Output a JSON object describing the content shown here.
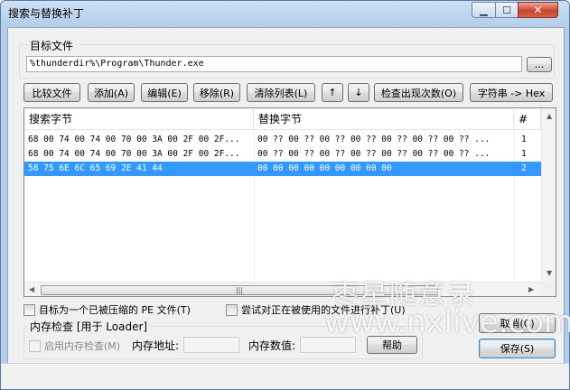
{
  "window": {
    "title": "搜索与替换补丁",
    "min_glyph": "▁",
    "max_glyph": "☐",
    "close_glyph": "✕"
  },
  "target": {
    "label": "目标文件",
    "path": "%thunderdir%\\Program\\Thunder.exe",
    "browse_label": "..."
  },
  "toolbar": {
    "compare": "比较文件",
    "add": "添加(A)",
    "edit": "编辑(E)",
    "remove": "移除(R)",
    "clear": "清除列表(L)",
    "up": "↑",
    "down": "↓",
    "check_count": "检查出现次数(O)",
    "str_to_hex": "字符串 -> Hex"
  },
  "list": {
    "columns": [
      "搜索字节",
      "替换字节",
      "#"
    ],
    "rows": [
      {
        "search": "68 00 74 00 74 00 70 00 3A 00 2F 00 2F...",
        "replace": "00 ?? 00 ?? 00 ?? 00 ?? 00 ?? 00 ?? 00 ?? ...",
        "count": "1",
        "selected": false
      },
      {
        "search": "68 00 74 00 74 00 70 00 3A 00 2F 00 2F...",
        "replace": "00 ?? 00 ?? 00 ?? 00 ?? 00 ?? 00 ?? 00 ?? ...",
        "count": "1",
        "selected": false
      },
      {
        "search": "58 75 6E 6C 65 69 2E 41 44",
        "replace": "00 00 00 00 00 00 00 00 00",
        "count": "2",
        "selected": true
      }
    ],
    "hscroll_grip": "|||"
  },
  "options": {
    "compressed_pe": "目标为一个已被压缩的 PE 文件(T)",
    "patch_in_use": "尝试对正在被使用的文件进行补丁(U)"
  },
  "memory": {
    "group_label": "内存检查 [用于 Loader]",
    "enable_label": "启用内存检查(M)",
    "address_label": "内存地址:",
    "address_value": "",
    "value_label": "内存数值:",
    "value_value": "",
    "help_label": "帮助"
  },
  "actions": {
    "cancel": "取消(C)",
    "save": "保存(S)"
  },
  "watermark": {
    "line1": "枣星随意录",
    "line2": "www.nxlive.com"
  }
}
